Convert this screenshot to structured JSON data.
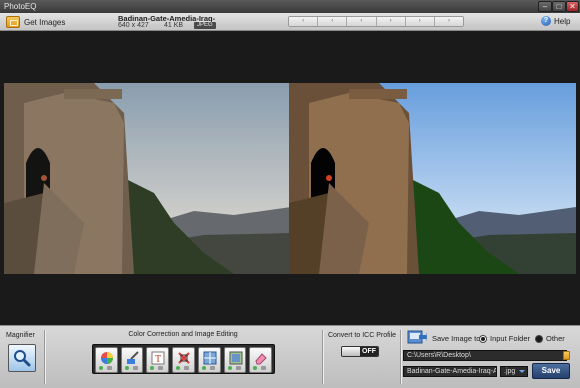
{
  "app": {
    "title": "PhotoEQ"
  },
  "window_controls": {
    "minimize": "–",
    "maximize": "□",
    "close": "✕"
  },
  "toolbar": {
    "get_images_label": "Get Images",
    "help_label": "Help",
    "help_icon_glyph": "?",
    "nav_buttons": [
      "‹",
      "‹",
      "‹",
      "›",
      "›",
      "›"
    ]
  },
  "file_info": {
    "name": "Badinan-Gate-Amedia-Iraq-",
    "dimensions": "640 x 427",
    "size": "41 KB",
    "format_badge": "JPEG"
  },
  "panel": {
    "magnifier_label": "Magnifier",
    "color_correction_label": "Color Correction and Image Editing",
    "tools": [
      {
        "icon": "color-wheel-icon"
      },
      {
        "icon": "brush-icon"
      },
      {
        "icon": "text-icon"
      },
      {
        "icon": "crop-icon"
      },
      {
        "icon": "resize-icon"
      },
      {
        "icon": "frame-icon"
      },
      {
        "icon": "eraser-icon"
      }
    ],
    "icc_label": "Convert to ICC Profile",
    "icc_state": "OFF",
    "save_to_label": "Save Image to",
    "save_options": [
      {
        "label": "Input Folder",
        "selected": true
      },
      {
        "label": "Other",
        "selected": false
      }
    ],
    "output_path": "C:\\Users\\R\\Desktop\\",
    "output_name": "Badinan-Gate-Amedia-Iraq-Au",
    "format": ".jpg",
    "save_button": "Save"
  },
  "colors": {
    "accent": "#2f4f80",
    "background": "#1c1c1c",
    "panel": "#cfcfcf"
  }
}
